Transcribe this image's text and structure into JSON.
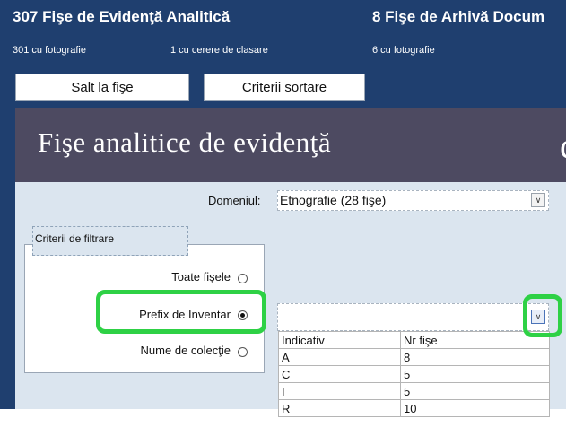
{
  "header": {
    "left": {
      "title": "307 Fişe de Evidenţă Analitică",
      "sub1": "301 cu fotografie",
      "sub2": "1 cu cerere de clasare"
    },
    "right": {
      "title": "8 Fişe de Arhivă Docum",
      "sub": "6 cu fotografie"
    }
  },
  "buttons": {
    "salt": "Salt la fişe",
    "criterii": "Criterii sortare"
  },
  "title": {
    "main": "Fişe analitice de evidenţă",
    "clipped": "c"
  },
  "domeniul": {
    "label": "Domeniul:",
    "value": "Etnografie  (28 fişe)"
  },
  "filter": {
    "legend": "Criterii de filtrare",
    "options": [
      {
        "label": "Toate fişele",
        "selected": false
      },
      {
        "label": "Prefix de Inventar",
        "selected": true
      },
      {
        "label": "Nume de colecţie",
        "selected": false
      }
    ]
  },
  "list": {
    "headers": [
      "Indicativ",
      "Nr fişe"
    ],
    "rows": [
      [
        "A",
        "8"
      ],
      [
        "C",
        "5"
      ],
      [
        "I",
        "5"
      ],
      [
        "R",
        "10"
      ]
    ]
  },
  "colors": {
    "header_bg": "#1f3f6f",
    "title_bg": "#4d4a61",
    "panel_bg": "#dbe5ef",
    "highlight": "#2ed145"
  }
}
